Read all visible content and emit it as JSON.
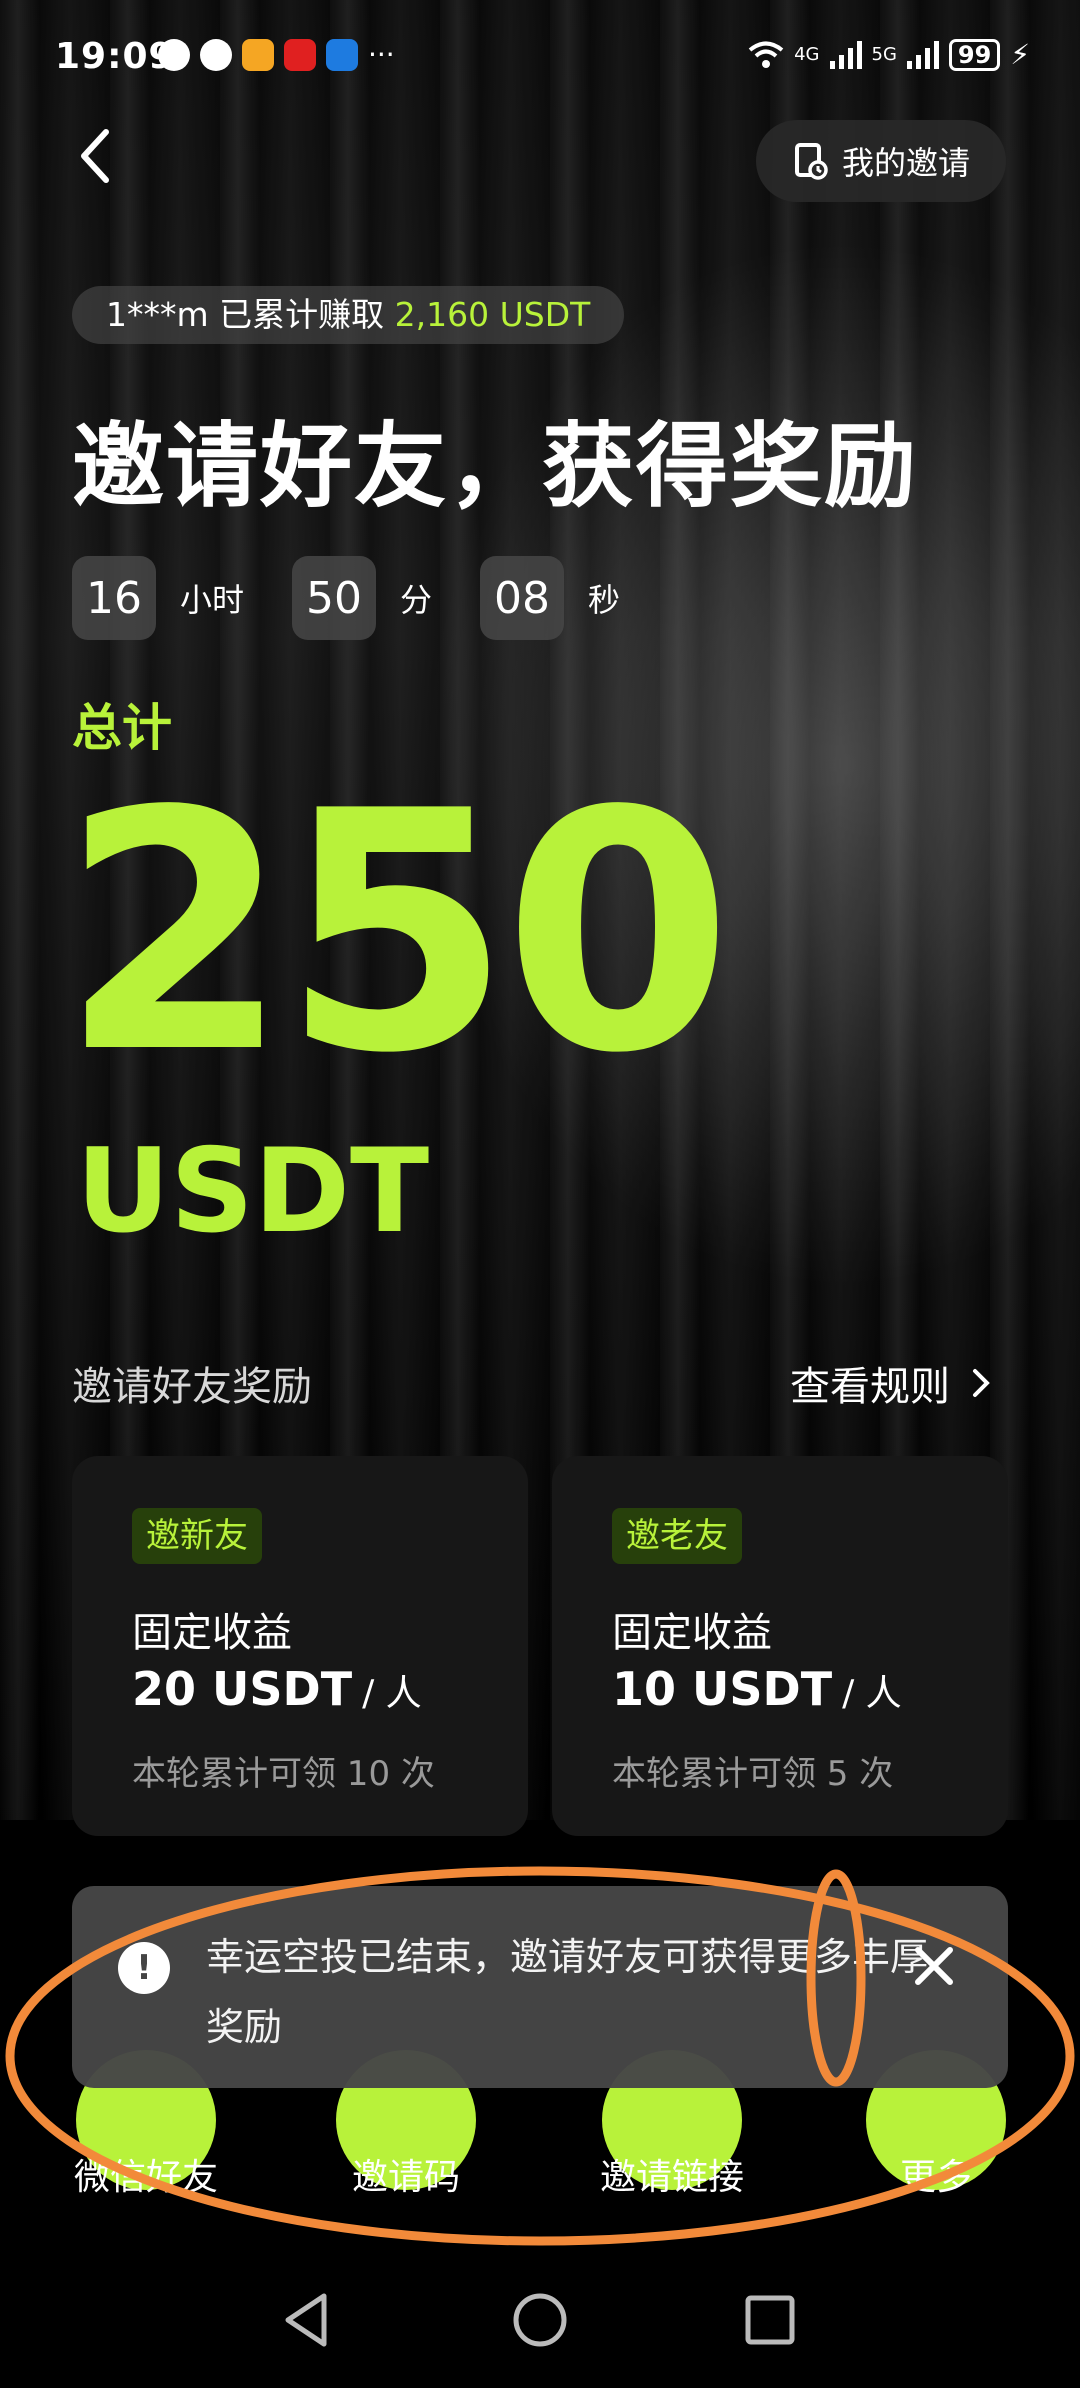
{
  "status_bar": {
    "time": "19:09",
    "network_1": "4G",
    "network_2": "5G",
    "battery": "99",
    "more_dots": "···"
  },
  "header": {
    "my_invite_label": "我的邀请"
  },
  "earned": {
    "user": "1***m",
    "text": "已累计赚取",
    "amount": "2,160 USDT"
  },
  "title": "邀请好友，获得奖励",
  "countdown": {
    "hours": "16",
    "hours_unit": "小时",
    "minutes": "50",
    "minutes_unit": "分",
    "seconds": "08",
    "seconds_unit": "秒"
  },
  "total": {
    "label": "总计",
    "amount": "250",
    "unit": "USDT"
  },
  "rewards": {
    "label": "邀请好友奖励",
    "rules_link": "查看规则",
    "cards": [
      {
        "tag": "邀新友",
        "type": "固定收益",
        "amount": "20 USDT",
        "per": "/ 人",
        "note": "本轮累计可领 10 次"
      },
      {
        "tag": "邀老友",
        "type": "固定收益",
        "amount": "10 USDT",
        "per": "/ 人",
        "note": "本轮累计可领 5 次"
      }
    ]
  },
  "toast": {
    "icon": "!",
    "message": "幸运空投已结束，邀请好友可获得更多丰厚奖励"
  },
  "share": {
    "options": [
      "微信好友",
      "邀请码",
      "邀请链接",
      "更多"
    ]
  },
  "colors": {
    "accent": "#b8f23a",
    "annotation": "#f28a3a"
  }
}
